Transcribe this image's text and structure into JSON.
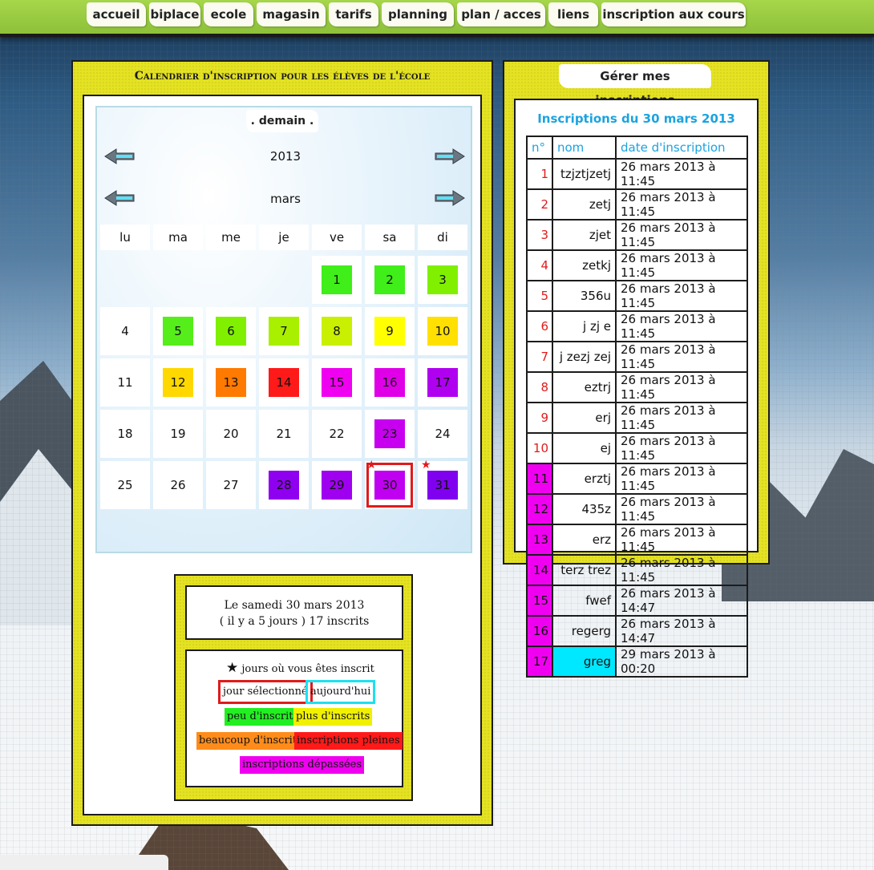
{
  "nav": [
    {
      "label": "accueil"
    },
    {
      "label": "biplace"
    },
    {
      "label": "ecole"
    },
    {
      "label": "magasin"
    },
    {
      "label": "tarifs"
    },
    {
      "label": "planning"
    },
    {
      "label": "plan / acces"
    },
    {
      "label": "liens"
    },
    {
      "label": "inscription aux cours"
    }
  ],
  "calendar_panel": {
    "title": "Calendrier d'inscription pour les élèves de l'école",
    "tomorrow_label": ". demain .",
    "year": "2013",
    "month": "mars",
    "weekdays": [
      "lu",
      "ma",
      "me",
      "je",
      "ve",
      "sa",
      "di"
    ]
  },
  "colors": {
    "few": "#7cff00",
    "more": "#e8f000",
    "many": "#ff7a00",
    "full": "#ff1a1a",
    "exceeded": "#f000f0",
    "selected": "#e01b1b",
    "today": "#00e8ff"
  },
  "days": [
    {
      "day": "1",
      "color": "#40ee1a"
    },
    {
      "day": "2",
      "color": "#40ee1a"
    },
    {
      "day": "3",
      "color": "#80f000"
    },
    {
      "day": "4",
      "color": ""
    },
    {
      "day": "5",
      "color": "#55ee1a"
    },
    {
      "day": "6",
      "color": "#80f000"
    },
    {
      "day": "7",
      "color": "#a8f000"
    },
    {
      "day": "8",
      "color": "#c8f000"
    },
    {
      "day": "9",
      "color": "#ffff00"
    },
    {
      "day": "10",
      "color": "#ffe000"
    },
    {
      "day": "11",
      "color": ""
    },
    {
      "day": "12",
      "color": "#ffd800"
    },
    {
      "day": "13",
      "color": "#ff7a00"
    },
    {
      "day": "14",
      "color": "#ff1a1a"
    },
    {
      "day": "15",
      "color": "#f000f0"
    },
    {
      "day": "16",
      "color": "#e000e8"
    },
    {
      "day": "17",
      "color": "#b000f0"
    },
    {
      "day": "18",
      "color": ""
    },
    {
      "day": "19",
      "color": ""
    },
    {
      "day": "20",
      "color": ""
    },
    {
      "day": "21",
      "color": ""
    },
    {
      "day": "22",
      "color": ""
    },
    {
      "day": "23",
      "color": "#c800f0"
    },
    {
      "day": "24",
      "color": ""
    },
    {
      "day": "25",
      "color": ""
    },
    {
      "day": "26",
      "color": ""
    },
    {
      "day": "27",
      "color": ""
    },
    {
      "day": "28",
      "color": "#9000f0"
    },
    {
      "day": "29",
      "color": "#a000f0"
    },
    {
      "day": "30",
      "color": "#c000f0",
      "selected": true,
      "star": true
    },
    {
      "day": "31",
      "color": "#8000f0",
      "star": true
    }
  ],
  "info": {
    "date_line": "Le samedi 30 mars 2013",
    "count_line": "( il y a 5 jours ) 17 inscrits"
  },
  "legend": {
    "star_text": "jours où vous êtes inscrit",
    "selected": "jour sélectionné",
    "today": "aujourd'hui",
    "few": "peu d'inscrits",
    "more": "plus d'inscrits",
    "many": "beaucoup d'inscrits",
    "full": "inscriptions pleines",
    "exceeded": "inscriptions dépassées"
  },
  "registrations": {
    "tab_label": "Gérer mes inscriptions",
    "title": "Inscriptions du 30 mars 2013",
    "headers": [
      "n°",
      "nom",
      "date d'inscription"
    ],
    "rows": [
      {
        "n": "1",
        "name": "tzjztjzetj",
        "date": "26 mars 2013 à 11:45",
        "over": false
      },
      {
        "n": "2",
        "name": "zetj",
        "date": "26 mars 2013 à 11:45",
        "over": false
      },
      {
        "n": "3",
        "name": "zjet",
        "date": "26 mars 2013 à 11:45",
        "over": false
      },
      {
        "n": "4",
        "name": "zetkj",
        "date": "26 mars 2013 à 11:45",
        "over": false
      },
      {
        "n": "5",
        "name": "356u",
        "date": "26 mars 2013 à 11:45",
        "over": false
      },
      {
        "n": "6",
        "name": "j zj e",
        "date": "26 mars 2013 à 11:45",
        "over": false
      },
      {
        "n": "7",
        "name": "j zezj zej",
        "date": "26 mars 2013 à 11:45",
        "over": false
      },
      {
        "n": "8",
        "name": "eztrj",
        "date": "26 mars 2013 à 11:45",
        "over": false
      },
      {
        "n": "9",
        "name": "erj",
        "date": "26 mars 2013 à 11:45",
        "over": false
      },
      {
        "n": "10",
        "name": "ej",
        "date": "26 mars 2013 à 11:45",
        "over": false
      },
      {
        "n": "11",
        "name": "erztj",
        "date": "26 mars 2013 à 11:45",
        "over": true
      },
      {
        "n": "12",
        "name": "435z",
        "date": "26 mars 2013 à 11:45",
        "over": true
      },
      {
        "n": "13",
        "name": "erz",
        "date": "26 mars 2013 à 11:45",
        "over": true
      },
      {
        "n": "14",
        "name": "terz trez",
        "date": "26 mars 2013 à 11:45",
        "over": true
      },
      {
        "n": "15",
        "name": "fwef",
        "date": "26 mars 2013 à 14:47",
        "over": true
      },
      {
        "n": "16",
        "name": "regerg",
        "date": "26 mars 2013 à 14:47",
        "over": true
      },
      {
        "n": "17",
        "name": "greg",
        "date": "29 mars 2013 à 00:20",
        "over": true,
        "me": true
      }
    ]
  }
}
